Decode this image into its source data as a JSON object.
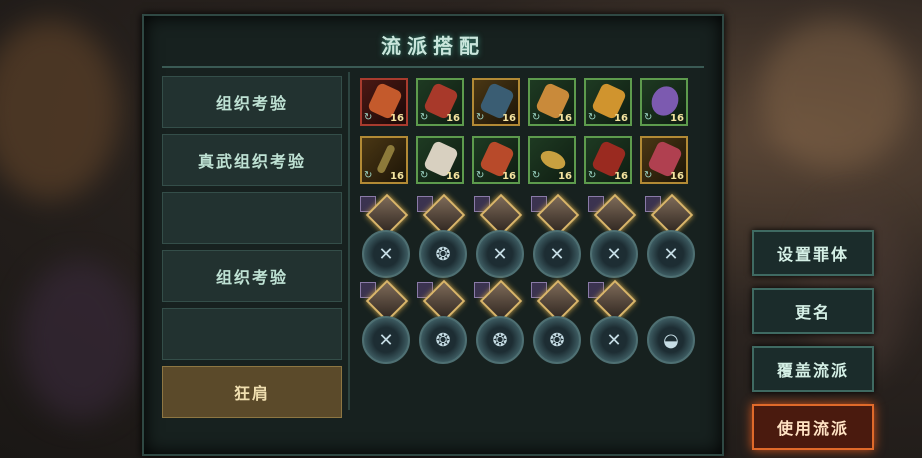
{
  "title": "流派搭配",
  "list": {
    "items": [
      {
        "label": "组织考验",
        "selected": false
      },
      {
        "label": "真武组织考验",
        "selected": false
      },
      {
        "label": "",
        "selected": false
      },
      {
        "label": "组织考验",
        "selected": false
      },
      {
        "label": "",
        "selected": false
      },
      {
        "label": "狂肩",
        "selected": true
      }
    ]
  },
  "equipment": {
    "row1": [
      {
        "icon": "staff-icon",
        "level": "16",
        "rarity": "red"
      },
      {
        "icon": "gauntlet-icon",
        "level": "16",
        "rarity": "green"
      },
      {
        "icon": "armor-icon",
        "level": "16",
        "rarity": "gold"
      },
      {
        "icon": "helmet-icon",
        "level": "16",
        "rarity": "green"
      },
      {
        "icon": "boots-icon",
        "level": "16",
        "rarity": "green"
      },
      {
        "icon": "orb-icon",
        "level": "16",
        "rarity": "green"
      }
    ],
    "row2": [
      {
        "icon": "spear-icon",
        "level": "16",
        "rarity": "gold"
      },
      {
        "icon": "robe-icon",
        "level": "16",
        "rarity": "green"
      },
      {
        "icon": "glove-icon",
        "level": "16",
        "rarity": "green"
      },
      {
        "icon": "ring-icon",
        "level": "16",
        "rarity": "green"
      },
      {
        "icon": "blade-icon",
        "level": "16",
        "rarity": "green"
      },
      {
        "icon": "charm-icon",
        "level": "16",
        "rarity": "green"
      }
    ]
  },
  "buttons": {
    "set_body": "设置罪体",
    "rename": "更名",
    "overwrite": "覆盖流派",
    "use": "使用流派"
  }
}
